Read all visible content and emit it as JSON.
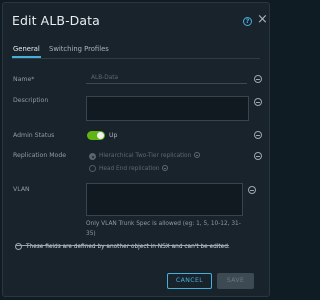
{
  "dialog": {
    "title": "Edit ALB-Data",
    "help_icon": "help-circle-icon",
    "close_glyph": "×"
  },
  "tabs": [
    {
      "label": "General",
      "active": true
    },
    {
      "label": "Switching Profiles",
      "active": false
    }
  ],
  "form": {
    "name": {
      "label": "Name*",
      "value": "ALB-Data"
    },
    "description": {
      "label": "Description",
      "value": ""
    },
    "admin_status": {
      "label": "Admin Status",
      "toggle_text": "Up",
      "on": true
    },
    "replication_mode": {
      "label": "Replication Mode",
      "options": [
        {
          "label": "Hierarchical Two-Tier replication",
          "selected": true
        },
        {
          "label": "Head End replication",
          "selected": false
        }
      ]
    },
    "vlan": {
      "label": "VLAN",
      "value": "",
      "help": "Only VLAN Trunk Spec is allowed (eg: 1, 5, 10-12, 31-35)"
    }
  },
  "footnote": "These fields are defined by another object in NSX and can't be edited.",
  "buttons": {
    "cancel": "CANCEL",
    "save": "SAVE"
  },
  "colors": {
    "accent": "#49afd9",
    "toggle_on": "#60b515",
    "background": "#19232b"
  }
}
